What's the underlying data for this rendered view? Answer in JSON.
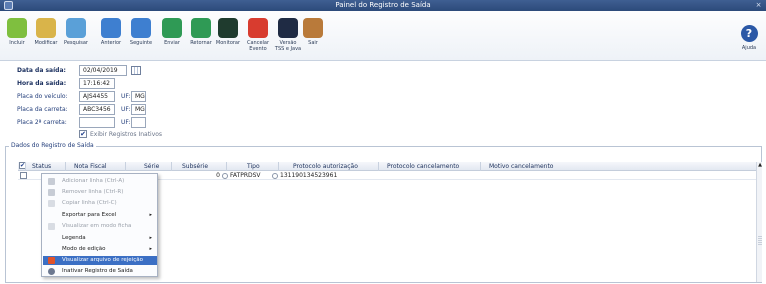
{
  "window": {
    "title": "Painel do Registro de Saída",
    "close_glyph": "×"
  },
  "toolbar": {
    "buttons": [
      {
        "label": "Incluir",
        "icon": "add-icon",
        "color": "#7fbf3f"
      },
      {
        "label": "Modificar",
        "icon": "edit-icon",
        "color": "#d9b44a"
      },
      {
        "label": "Pesquisar",
        "icon": "search-icon",
        "color": "#5aa0d8"
      },
      {
        "label": "Anterior",
        "icon": "arrow-left-icon",
        "color": "#3e7fd0"
      },
      {
        "label": "Seguinte",
        "icon": "arrow-right-icon",
        "color": "#3e7fd0"
      },
      {
        "label": "Enviar",
        "icon": "send-icon",
        "color": "#2f9a55"
      },
      {
        "label": "Retornar",
        "icon": "return-icon",
        "color": "#2f9a55"
      },
      {
        "label": "Monitorar",
        "icon": "monitor-icon",
        "color": "#1f3b2e"
      },
      {
        "label": "Cancelar\nEvento",
        "icon": "cancel-icon",
        "color": "#d83c2f"
      },
      {
        "label": "Versão\nTSS e Java",
        "icon": "version-icon",
        "color": "#1f2b44"
      },
      {
        "label": "Sair",
        "icon": "exit-icon",
        "color": "#b97a3a"
      }
    ],
    "help_label": "Ajuda",
    "help_glyph": "?"
  },
  "form": {
    "data_saida_label": "Data da saída:",
    "data_saida_value": "02/04/2019",
    "hora_saida_label": "Hora da saída:",
    "hora_saida_value": "17:16:42",
    "placa_veiculo_label": "Placa do veículo:",
    "placa_veiculo_value": "AJS4455",
    "placa_veiculo_uf_label": "UF:",
    "placa_veiculo_uf": "MG",
    "placa_carreta_label": "Placa da carreta:",
    "placa_carreta_value": "ABC3456",
    "placa_carreta_uf_label": "UF:",
    "placa_carreta_uf": "MG",
    "placa2_carreta_label": "Placa 2ª carreta:",
    "placa2_carreta_value": "",
    "placa2_carreta_uf_label": "UF:",
    "placa2_carreta_uf": "",
    "exibir_inativos_label": "Exibir Registros Inativos",
    "exibir_inativos_checked": "✔"
  },
  "grid": {
    "section_title": "Dados do Registro de Saída",
    "columns": [
      "Status",
      "Nota Fiscal",
      "Série",
      "Subsérie",
      "Tipo",
      "Protocolo autorização",
      "Protocolo cancelamento",
      "Motivo cancelamento"
    ],
    "row": {
      "subserie": "0",
      "tipo": "FATPRDSV",
      "protocolo_autorizacao": "131190134523961"
    }
  },
  "context_menu": {
    "items": [
      {
        "label": "Adicionar linha (Ctrl-A)",
        "disabled": true,
        "icon_color": "#b8bec8"
      },
      {
        "label": "Remover linha (Ctrl-R)",
        "disabled": true,
        "icon_color": "#b8bec8"
      },
      {
        "label": "Copiar linha (Ctrl-C)",
        "disabled": true,
        "icon_color": "#b8bec8"
      },
      {
        "label": "Exportar para Excel",
        "disabled": false,
        "submenu": true
      },
      {
        "label": "Visualizar em modo ficha",
        "disabled": true,
        "icon_color": "#b8bec8"
      },
      {
        "label": "Legenda",
        "disabled": false,
        "submenu": true
      },
      {
        "label": "Modo de edição",
        "disabled": false,
        "submenu": true
      },
      {
        "label": "Visualizar arquivo de rejeição",
        "disabled": false,
        "active": true,
        "icon_color": "#e0532b"
      },
      {
        "label": "Inativar Registro de Saída",
        "disabled": false,
        "icon_color": "#6c7890"
      }
    ],
    "submenu_glyph": "▸"
  },
  "colors": {
    "titlebar": "#2c4a7a",
    "accent": "#3b6fc4",
    "label": "#223d7a"
  }
}
